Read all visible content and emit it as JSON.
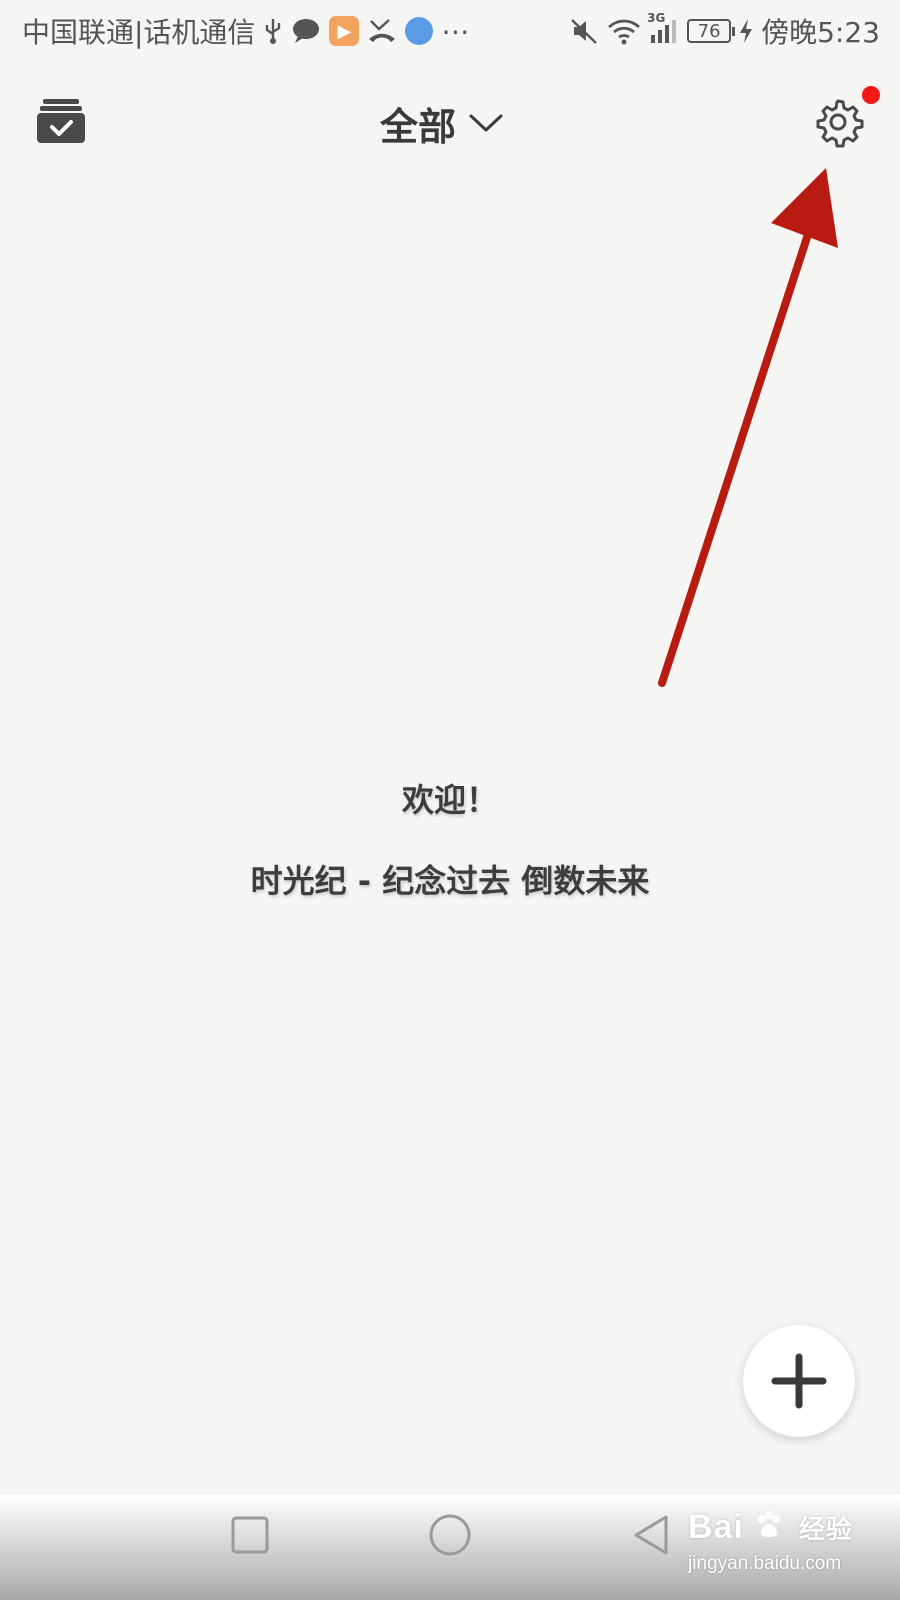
{
  "status_bar": {
    "carrier": "中国联通|话机通信",
    "time_text": "傍晚5:23",
    "battery_level": "76",
    "network_label": "3G",
    "icons_left": [
      "usb-icon",
      "message-icon",
      "video-app-icon",
      "missed-call-icon",
      "browser-icon",
      "more-icon"
    ],
    "icons_right": [
      "mute-icon",
      "wifi-icon",
      "signal-icon",
      "battery-icon",
      "charging-icon"
    ]
  },
  "header": {
    "title": "全部",
    "left_icon": "archive-check-icon",
    "right_icon": "gear-icon",
    "notification_dot_color": "#f21818"
  },
  "main": {
    "welcome": "欢迎！",
    "tagline": "时光纪 - 纪念过去 倒数未来"
  },
  "fab": {
    "icon": "plus-icon"
  },
  "annotation": {
    "arrow_color": "#b81b12"
  },
  "nav_bar": {
    "buttons": [
      "recent-apps-icon",
      "home-icon",
      "back-icon"
    ]
  },
  "watermark": {
    "logo": "Bai",
    "logo_suffix": "经验",
    "url": "jingyan.baidu.com"
  }
}
